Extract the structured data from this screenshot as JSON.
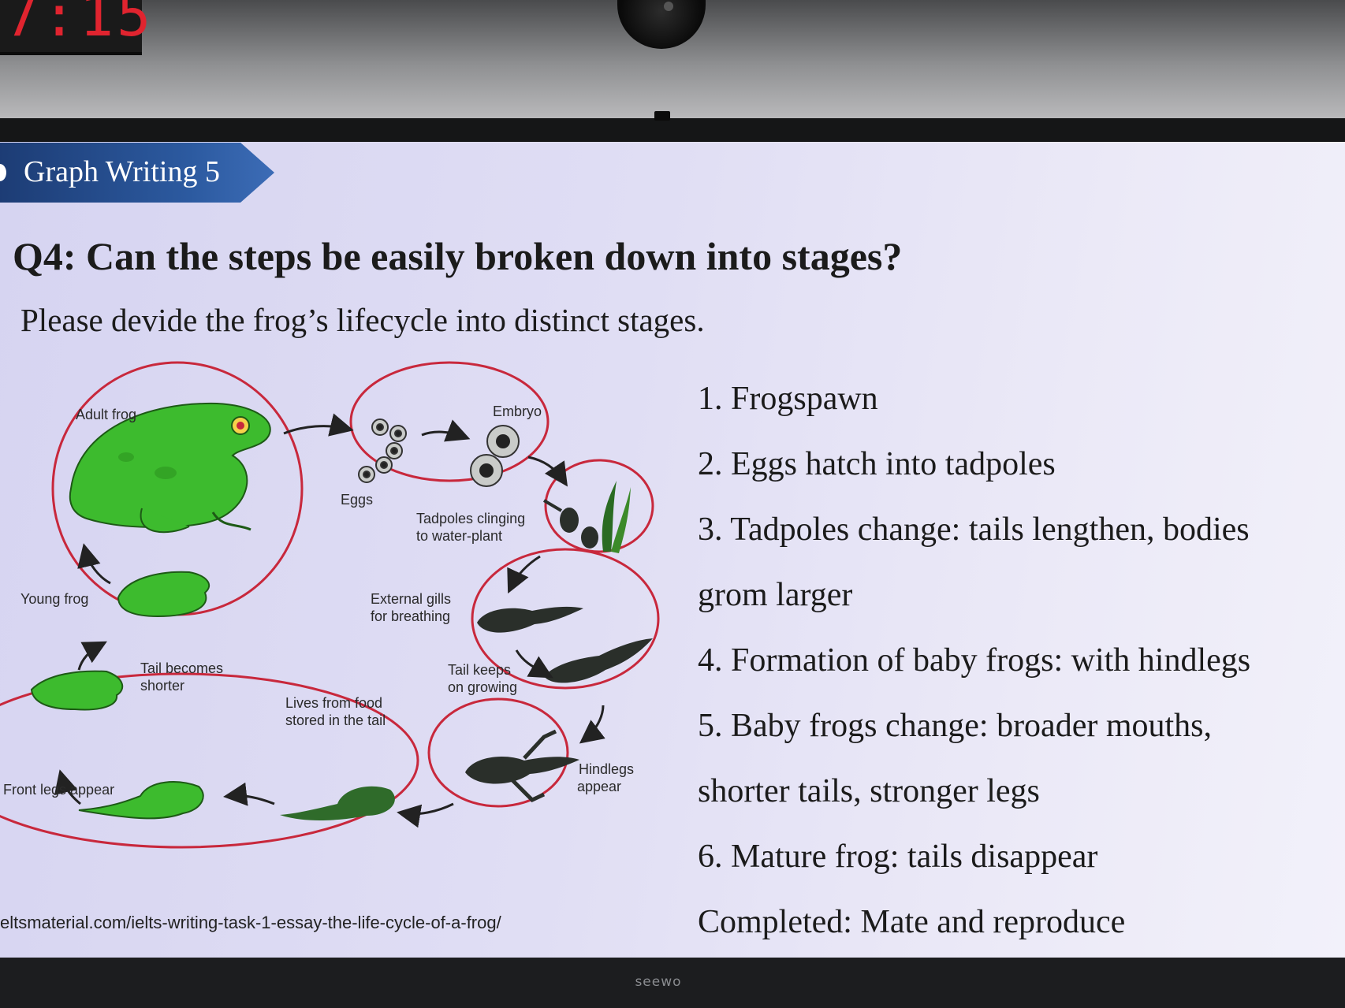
{
  "clock": {
    "digits": "7:15"
  },
  "tv": {
    "brand": "seewo"
  },
  "slide": {
    "banner": "Graph Writing 5",
    "question": "Q4: Can the steps be easily broken down into stages?",
    "instruction": "Please devide the frog’s lifecycle into distinct stages.",
    "stages": [
      "1. Frogspawn",
      "2. Eggs hatch into tadpoles",
      "3. Tadpoles change: tails lengthen, bodies",
      "grom larger",
      "4. Formation of baby frogs: with hindlegs",
      "5. Baby frogs change: broader mouths,",
      "shorter tails, stronger legs",
      "6. Mature frog: tails disappear",
      "Completed: Mate and reproduce"
    ],
    "source_url": "eltsmaterial.com/ielts-writing-task-1-essay-the-life-cycle-of-a-frog/"
  },
  "diagram": {
    "labels": {
      "adult_frog": "Adult frog",
      "embryo": "Embryo",
      "eggs": "Eggs",
      "tadpoles_clinging_1": "Tadpoles clinging",
      "tadpoles_clinging_2": "to water-plant",
      "young_frog": "Young frog",
      "external_gills_1": "External gills",
      "external_gills_2": "for breathing",
      "tail_shorter_1": "Tail becomes",
      "tail_shorter_2": "shorter",
      "tail_grows_1": "Tail keeps",
      "tail_grows_2": "on growing",
      "lives_food_1": "Lives from food",
      "lives_food_2": "stored in the tail",
      "hindlegs_1": "Hindlegs",
      "hindlegs_2": "appear",
      "front_legs": "Front legs appear"
    },
    "colors": {
      "circle": "#c8283c",
      "frog": "#3dbb2e",
      "tadpole": "#2a2f2a"
    }
  }
}
